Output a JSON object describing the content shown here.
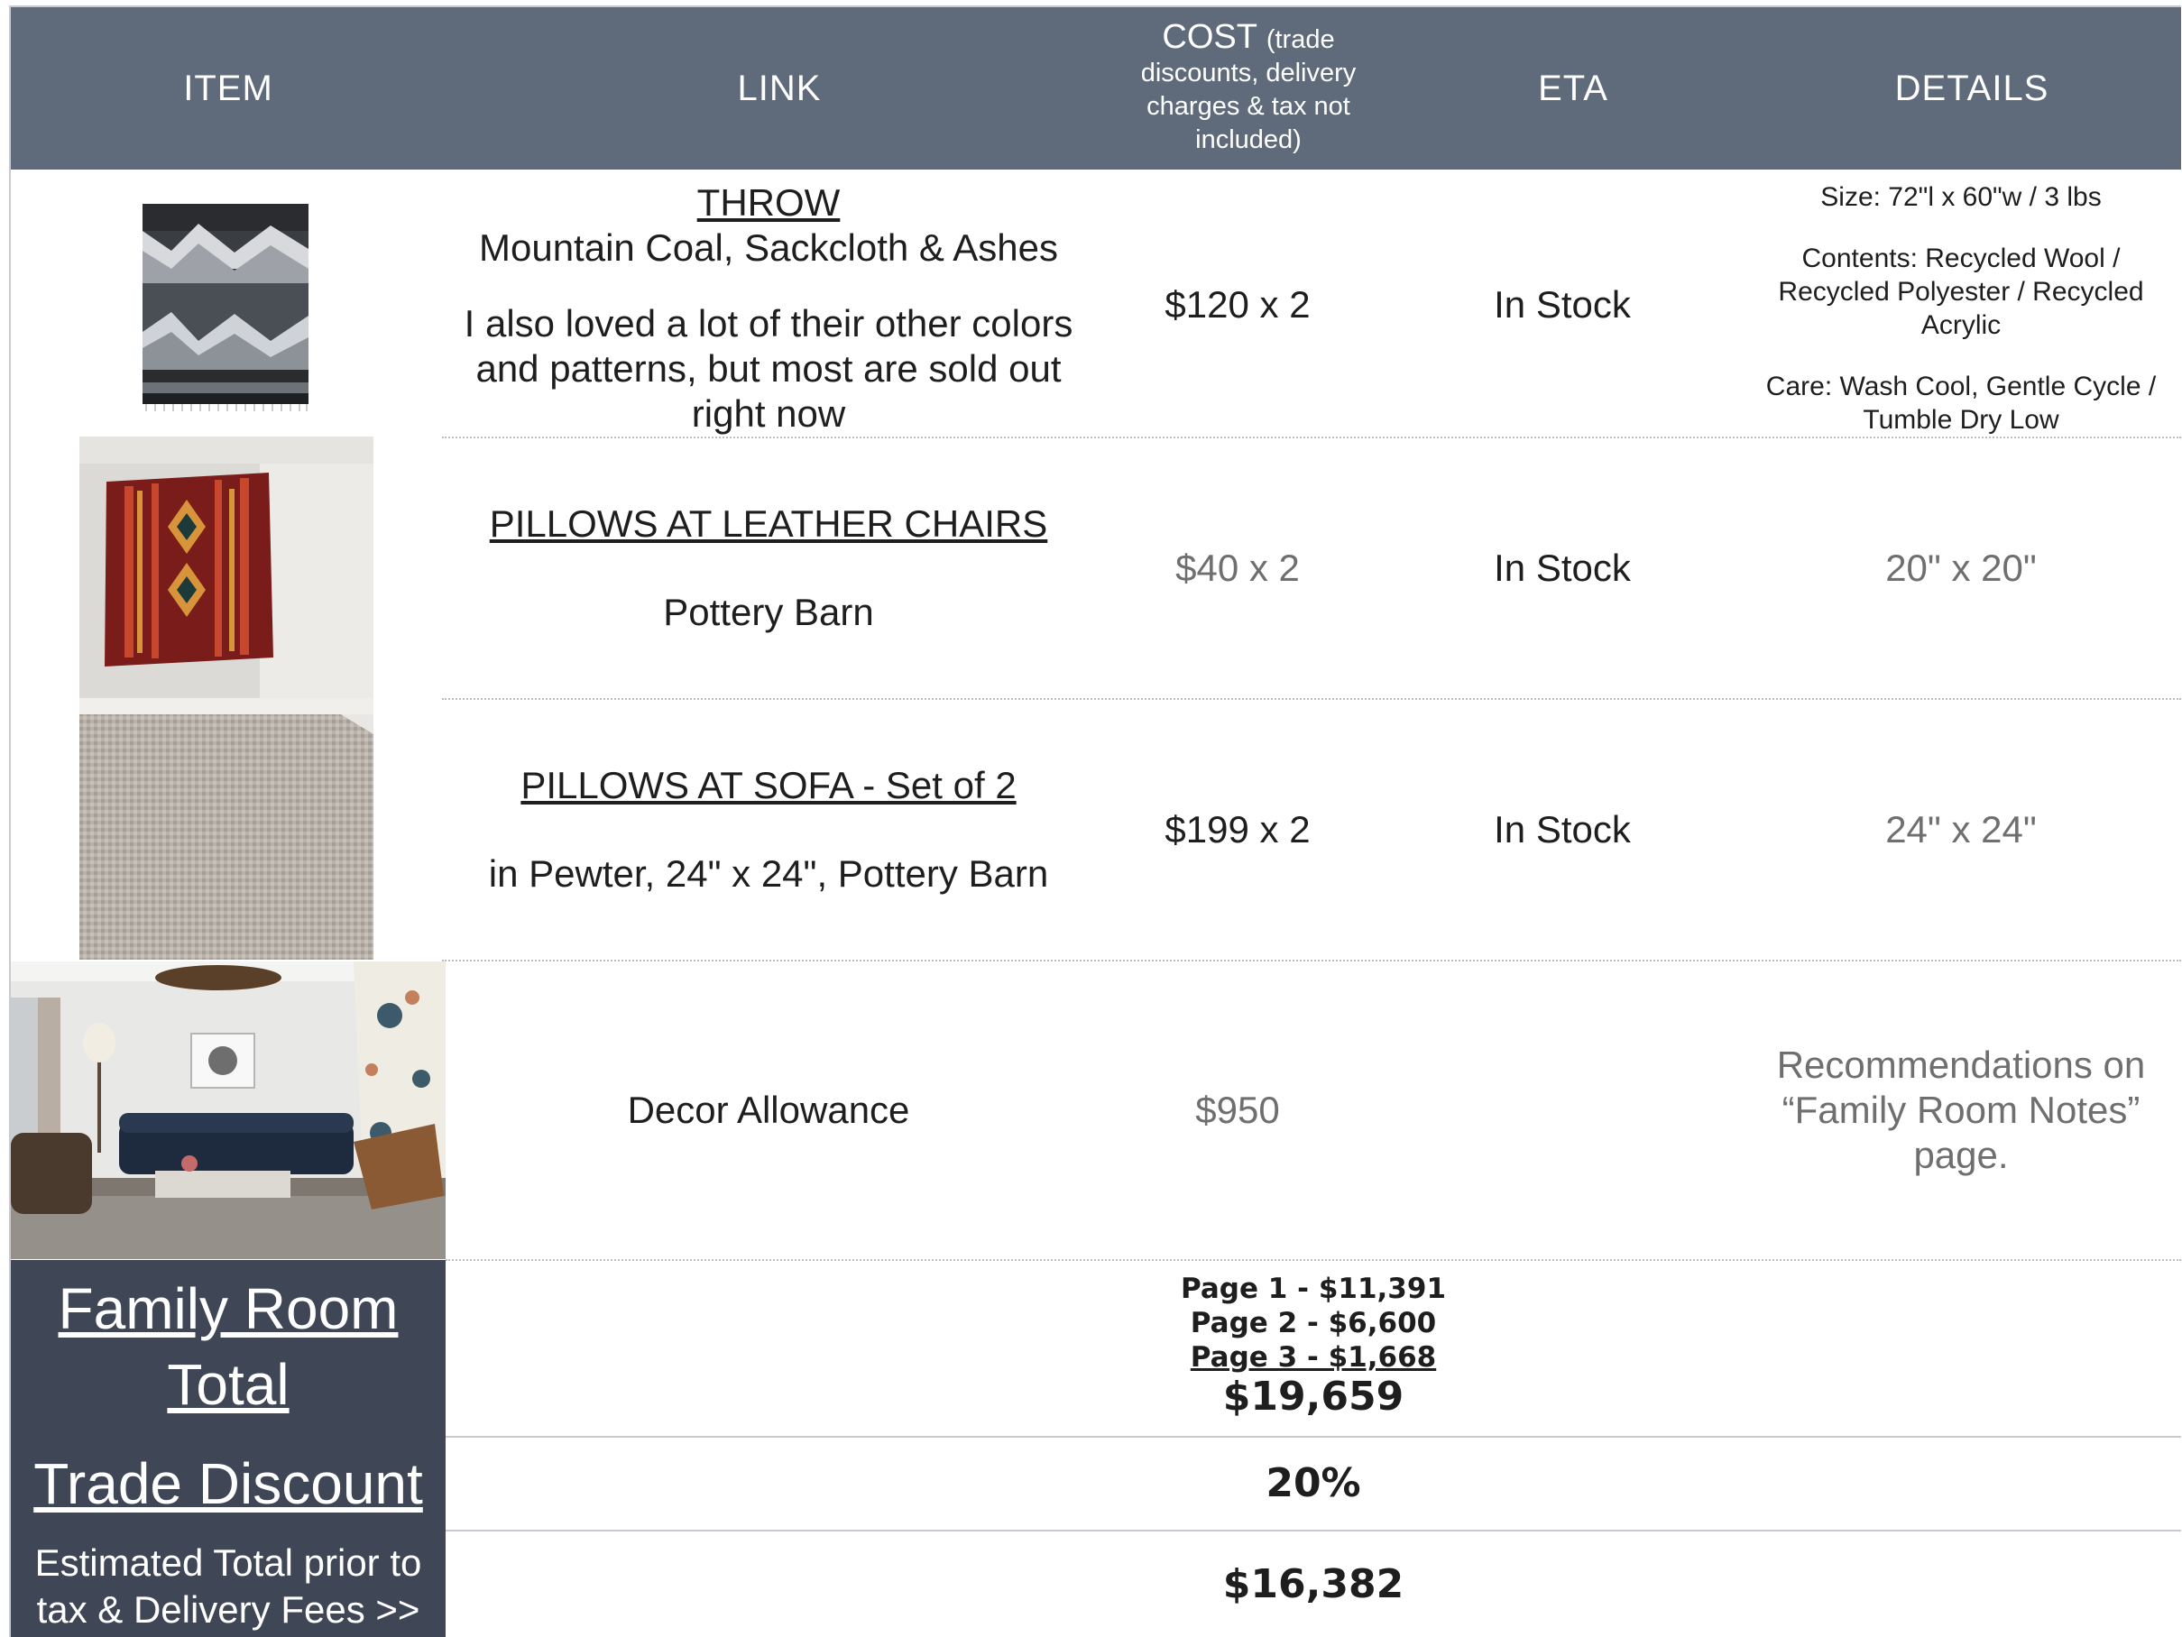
{
  "header": {
    "item": "ITEM",
    "link": "LINK",
    "cost_main": "COST",
    "cost_paren_start": "(trade",
    "cost_line2": "discounts, delivery",
    "cost_line3": "charges & tax not",
    "cost_line4": "included)",
    "eta": "ETA",
    "details": "DETAILS"
  },
  "rows": [
    {
      "link_title": "THROW",
      "link_sub": "Mountain Coal, Sackcloth & Ashes",
      "link_note_1": "I also loved a lot of their other colors",
      "link_note_2": "and patterns, but most are sold out",
      "link_note_3": "right now",
      "cost": "$120 x 2",
      "eta": "In Stock",
      "details_size": "Size:  72\"l x 60\"w / 3 lbs",
      "details_contents_1": "Contents:  Recycled Wool /",
      "details_contents_2": "Recycled Polyester / Recycled",
      "details_contents_3": "Acrylic",
      "details_care_1": "Care:  Wash Cool, Gentle Cycle /",
      "details_care_2": "Tumble Dry Low"
    },
    {
      "link_title": "PILLOWS AT LEATHER CHAIRS",
      "link_sub": "Pottery Barn",
      "cost": "$40 x 2",
      "eta": "In Stock",
      "details": "20\" x 20\""
    },
    {
      "link_title": "PILLOWS AT SOFA - Set of 2",
      "link_sub": "in Pewter, 24\" x 24\", Pottery Barn",
      "cost": "$199 x 2",
      "eta": "In Stock",
      "details": "24\" x 24\""
    },
    {
      "link_title": "Decor Allowance",
      "cost": "$950",
      "details_1": "Recommendations on",
      "details_2": "“Family Room Notes”",
      "details_3": "page."
    }
  ],
  "totals": {
    "label_1": "Family Room",
    "label_2": "Total",
    "page1": "Page 1 - $11,391",
    "page2": "Page 2 - $6,600",
    "page3": "Page 3 - $1,668",
    "total": "$19,659",
    "discount_label": "Trade Discount",
    "discount": "20%",
    "estimate_label_1": "Estimated Total prior to",
    "estimate_label_2": "tax & Delivery Fees >>",
    "estimate": "$16,382"
  }
}
